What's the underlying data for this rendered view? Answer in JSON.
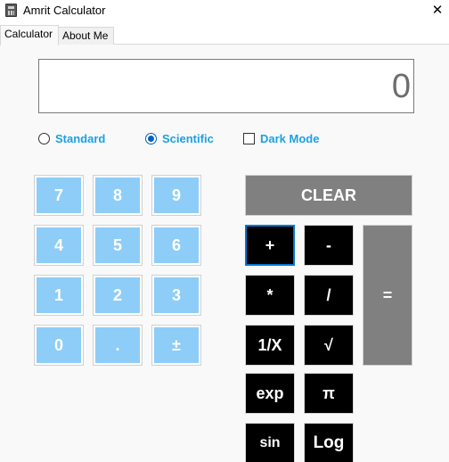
{
  "window": {
    "title": "Amrit Calculator",
    "close_glyph": "✕",
    "icon": "calculator-icon"
  },
  "tabs": [
    {
      "label": "Calculator",
      "active": true
    },
    {
      "label": "About Me",
      "active": false
    }
  ],
  "display": {
    "value": "0"
  },
  "modes": {
    "standard": {
      "label": "Standard",
      "selected": false
    },
    "scientific": {
      "label": "Scientific",
      "selected": true
    },
    "dark_mode": {
      "label": "Dark Mode",
      "checked": false
    }
  },
  "keypad": {
    "digits": [
      "7",
      "8",
      "9",
      "4",
      "5",
      "6",
      "1",
      "2",
      "3",
      "0",
      ".",
      "±"
    ],
    "clear": "CLEAR",
    "operators": [
      "+",
      "-",
      "*",
      "/",
      "1/X",
      "√",
      "exp",
      "π",
      "sin",
      "Log"
    ],
    "equals": "="
  },
  "colors": {
    "digit_button": "#8ecdf7",
    "operator_button": "#000000",
    "clear_button": "#808080",
    "option_text": "#1ba1e2"
  }
}
